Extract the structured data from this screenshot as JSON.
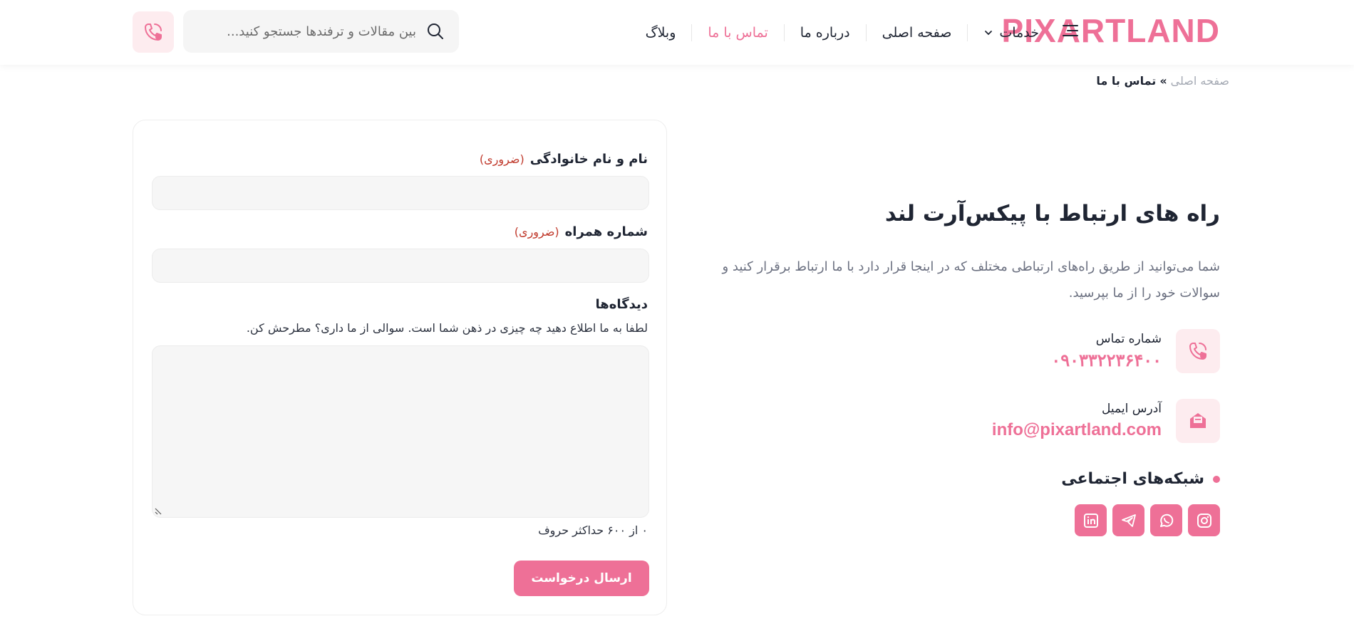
{
  "header": {
    "logo_text": "PIXARTLAND",
    "nav": [
      {
        "label": "خدمات",
        "has_dropdown": true
      },
      {
        "label": "صفحه اصلی"
      },
      {
        "label": "درباره ما"
      },
      {
        "label": "تماس با ما",
        "active": true
      },
      {
        "label": "وبلاگ"
      }
    ],
    "search_placeholder": "بین مقالات و ترفندها جستجو کنید..."
  },
  "breadcrumb": {
    "home": "صفحه اصلی",
    "separator": "»",
    "current": "تماس با ما"
  },
  "form": {
    "name_label": "نام و نام خانوادگی",
    "name_required": "(ضروری)",
    "phone_label": "شماره همراه",
    "phone_required": "(ضروری)",
    "comments_label": "دیدگاه‌ها",
    "comments_hint": "لطفا به ما اطلاع دهید چه چیزی در ذهن شما است. سوالی از ما داری؟ مطرحش کن.",
    "counter": "۰ از ۶۰۰ حداکثر حروف",
    "submit_label": "ارسال درخواست"
  },
  "info": {
    "title": "راه های ارتباط با پیکس‌آرت لند",
    "description": "شما می‌توانید از طریق راه‌های ارتباطی مختلف که در اینجا قرار دارد با ما ارتباط برقرار کنید و سوالات خود را از ما بپرسید.",
    "phone_label": "شماره تماس",
    "phone_value": "۰۹۰۳۳۲۲۳۶۴۰۰",
    "email_label": "آدرس ایمیل",
    "email_value": "info@pixartland.com",
    "social_title": "شبکه‌های اجتماعی",
    "socials": [
      "instagram-icon",
      "whatsapp-icon",
      "telegram-icon",
      "linkedin-icon"
    ]
  },
  "colors": {
    "accent": "#ee7097",
    "accent_soft": "#fdecef",
    "required": "#c0392b"
  }
}
